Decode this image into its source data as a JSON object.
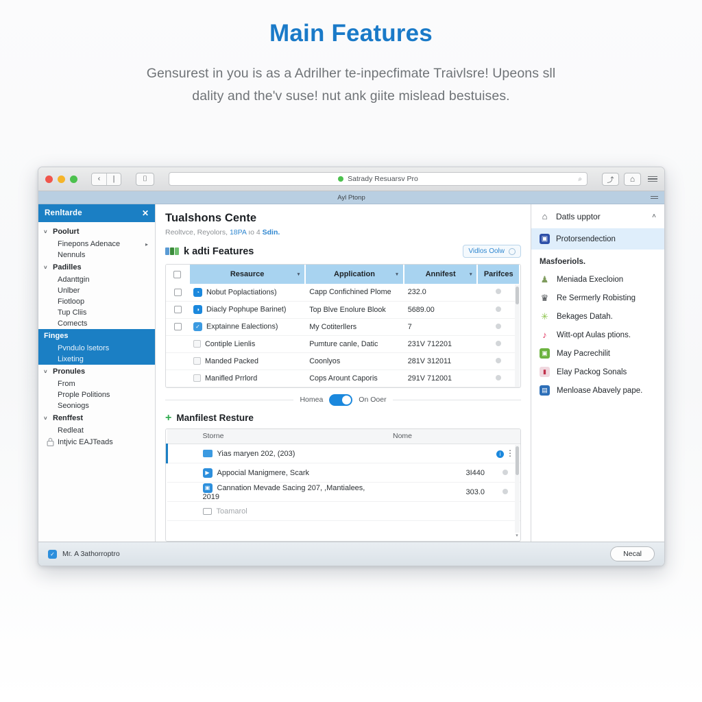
{
  "hero": {
    "title": "Main Features",
    "subtitle": "Gensurest in you is as a Adrilher te-inpecfimate Traivlsre! Upeons sll dality and the'v suse! nut ank giite mislead bestuises."
  },
  "titlebar": {
    "back_icon": "‹",
    "forward_icon": "|",
    "sidebar_toggle_icon": "⌷",
    "address_value": "Satrady Resuarsv Pro",
    "search_icon": "⌕",
    "share_icon": "⤴",
    "home_icon": "⌂",
    "menu_icon": "hamburger-icon",
    "tab_title": "Ayl Ptonp"
  },
  "sidebar": {
    "header": "Renltarde",
    "close_icon": "✕",
    "groups": [
      {
        "label": "Poolurt",
        "chevron": "˅",
        "selected": false,
        "items": [
          {
            "label": "Finepons Adenace",
            "arrow": "▸"
          },
          {
            "label": "Nennuls",
            "arrow": ""
          }
        ]
      },
      {
        "label": "Padilles",
        "chevron": "˅",
        "selected": false,
        "items": [
          {
            "label": "Adanttgin",
            "arrow": ""
          },
          {
            "label": "Unlber",
            "arrow": ""
          },
          {
            "label": "Fiotloop",
            "arrow": ""
          },
          {
            "label": "Tup Cliis",
            "arrow": ""
          },
          {
            "label": "Comects",
            "arrow": ""
          }
        ]
      },
      {
        "label": "Finges",
        "chevron": "",
        "selected": true,
        "items": [
          {
            "label": "Pvndulo lsetors",
            "arrow": ""
          },
          {
            "label": "Lixeting",
            "arrow": ""
          }
        ]
      },
      {
        "label": "Pronules",
        "chevron": "˅",
        "selected": false,
        "items": [
          {
            "label": "From",
            "arrow": ""
          },
          {
            "label": "Prople Politions",
            "arrow": ""
          },
          {
            "label": "Seoniogs",
            "arrow": ""
          }
        ]
      },
      {
        "label": "Renffest",
        "chevron": "˅",
        "selected": false,
        "items": [
          {
            "label": "Redleat",
            "arrow": ""
          },
          {
            "label": "Intjvic EAJTeads",
            "arrow": "",
            "lock": true
          }
        ]
      }
    ]
  },
  "main": {
    "title": "Tualshons Cente",
    "breadcrumb_plain": "Reoltvce,  Reyolors, ",
    "breadcrumb_link": "18PA",
    "breadcrumb_mid": " ıo 4 ",
    "breadcrumb_bold": "Sdin.",
    "section_title": "k adti Features",
    "section_button": "Vidlos Oolw",
    "section_button_icon": "ⓞ",
    "table1": {
      "columns": [
        "",
        "Resaurce",
        "Application",
        "Annifest",
        "Parifces"
      ],
      "column_carets": [
        "",
        "▾",
        "▾",
        "▾",
        ""
      ],
      "rows": [
        {
          "checked": false,
          "icon_color": "#1b88dd",
          "icon_glyph": "◔",
          "resource": "Nobut Poplactiations)",
          "application": "Capр Confichined Plome",
          "annifest": "232.0",
          "dim": false
        },
        {
          "checked": false,
          "icon_color": "#1b88dd",
          "icon_glyph": "◑",
          "resource": "Diacly Pophupe Barinet)",
          "application": "Top Blve Enolure Blook",
          "annifest": "5689.00",
          "dim": false
        },
        {
          "checked": false,
          "icon_color": "#3b9ae1",
          "icon_glyph": "✓",
          "resource": "Exptainne Ealections)",
          "application": "My Cotiterllers",
          "annifest": "7",
          "dim": false
        },
        {
          "checked": true,
          "icon_color": "#d5d8db",
          "icon_glyph": "✓",
          "resource": "Contiple Lienlis",
          "application": "Pumture canle, Datic",
          "annifest": "231V 712201",
          "dim": true
        },
        {
          "checked": true,
          "icon_color": "#d5d8db",
          "icon_glyph": "✓",
          "resource": "Manded Packed",
          "application": "Coonlyos",
          "annifest": "281V 312011",
          "dim": true
        },
        {
          "checked": true,
          "icon_color": "#d5d8db",
          "icon_glyph": "✓",
          "resource": "Manifled Prrlord",
          "application": "Cops Arount Caporis",
          "annifest": "291V 712001",
          "dim": true
        }
      ]
    },
    "toggle": {
      "left_label": "Homea",
      "right_label": "On Ooer",
      "on": true
    },
    "section2_title": "Manfilest Resture",
    "section2_plus": "+",
    "table2": {
      "columns": [
        "",
        "Storne",
        "Nome"
      ],
      "rows": [
        {
          "selected": true,
          "kind": "folder",
          "name": "Yias maryen 202, (203)",
          "value": "",
          "info": true,
          "kebab": true
        },
        {
          "selected": false,
          "kind": "app",
          "name": "Appocial Manigmere, Scark",
          "value": "3І440",
          "info": false,
          "kebab": false
        },
        {
          "selected": false,
          "kind": "app",
          "name": "Cannation Mevade Sacing 207, ,Mantialees, 2019",
          "value": "303.0",
          "info": false,
          "kebab": false
        },
        {
          "selected": false,
          "kind": "tray",
          "name": "Toamarol",
          "value": "",
          "info": false,
          "kebab": false
        }
      ]
    }
  },
  "rightpanel": {
    "header": "Datls upptor",
    "header_icon": "⌂",
    "collapse_icon": "˄",
    "selected_item": {
      "label": "Protorsendection",
      "icon_color": "#2d4fa8",
      "icon_glyph": "⬚"
    },
    "group_label": "Masfoeriols.",
    "items": [
      {
        "label": "Meniada Execloion",
        "icon_color": "#7f9c5e",
        "icon_glyph": "♟"
      },
      {
        "label": "Re Sermerly Robisting",
        "icon_color": "#3f4347",
        "icon_glyph": "♛"
      },
      {
        "label": "Bekages Datah.",
        "icon_color": "#8bc34a",
        "icon_glyph": "✳"
      },
      {
        "label": "Witt-opt Aulas ptions.",
        "icon_color": "#e0315c",
        "icon_glyph": "♪"
      },
      {
        "label": "May Pacrechilit",
        "icon_color": "#6cb33f",
        "icon_glyph": "▣"
      },
      {
        "label": "Elay Packog Sonals",
        "icon_color": "#c0304a",
        "icon_glyph": "▮"
      },
      {
        "label": "Menloase Abavely pape.",
        "icon_color": "#2d6fb8",
        "icon_glyph": "▤"
      }
    ]
  },
  "statusbar": {
    "checkbox_icon": "✓",
    "label": "Mг. A 3athorroptro",
    "button": "Necal"
  }
}
